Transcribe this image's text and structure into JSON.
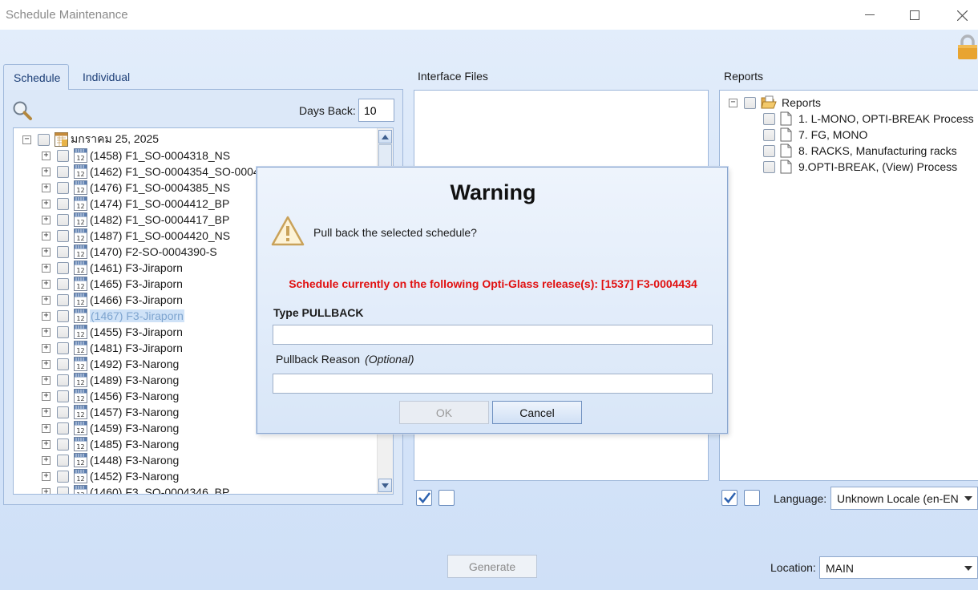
{
  "window": {
    "title": "Schedule Maintenance"
  },
  "tabs": [
    {
      "label": "Schedule",
      "active": true
    },
    {
      "label": "Individual",
      "active": false
    }
  ],
  "schedule": {
    "days_back_label": "Days Back:",
    "days_back_value": "10",
    "root_label": "มกราคม 25, 2025",
    "items": [
      {
        "label": "(1458) F1_SO-0004318_NS"
      },
      {
        "label": "(1462) F1_SO-0004354_SO-0004"
      },
      {
        "label": "(1476) F1_SO-0004385_NS"
      },
      {
        "label": "(1474) F1_SO-0004412_BP"
      },
      {
        "label": "(1482) F1_SO-0004417_BP"
      },
      {
        "label": "(1487) F1_SO-0004420_NS"
      },
      {
        "label": "(1470) F2-SO-0004390-S"
      },
      {
        "label": "(1461) F3-Jiraporn"
      },
      {
        "label": "(1465) F3-Jiraporn"
      },
      {
        "label": "(1466) F3-Jiraporn"
      },
      {
        "label": "(1467) F3-Jiraporn",
        "selected": true
      },
      {
        "label": "(1455) F3-Jiraporn"
      },
      {
        "label": "(1481) F3-Jiraporn"
      },
      {
        "label": "(1492) F3-Narong"
      },
      {
        "label": "(1489) F3-Narong"
      },
      {
        "label": "(1456) F3-Narong"
      },
      {
        "label": "(1457) F3-Narong"
      },
      {
        "label": "(1459) F3-Narong"
      },
      {
        "label": "(1485) F3-Narong"
      },
      {
        "label": "(1448) F3-Narong"
      },
      {
        "label": "(1452) F3-Narong"
      },
      {
        "label": "(1460) F3_SO-0004346_BP"
      }
    ]
  },
  "interface_files": {
    "label": "Interface Files"
  },
  "reports": {
    "label": "Reports",
    "root_label": "Reports",
    "items": [
      {
        "label": "1. L-MONO, OPTI-BREAK Process"
      },
      {
        "label": "7. FG, MONO"
      },
      {
        "label": "8. RACKS, Manufacturing racks"
      },
      {
        "label": "9.OPTI-BREAK, (View) Process"
      }
    ]
  },
  "language": {
    "label": "Language:",
    "value": "Unknown Locale (en-EN"
  },
  "location": {
    "label": "Location:",
    "value": "MAIN"
  },
  "generate_label": "Generate",
  "dialog": {
    "title": "Warning",
    "message": "Pull back the selected schedule?",
    "release_notice": "Schedule currently on the following Opti-Glass release(s): [1537] F3-0004434",
    "type_label": "Type PULLBACK",
    "reason_label": "Pullback Reason",
    "reason_optional": "(Optional)",
    "ok_label": "OK",
    "cancel_label": "Cancel"
  },
  "colors": {
    "accent": "#1d3f77",
    "warning_red": "#e11010",
    "lock_gold": "#e8a430"
  },
  "icons": [
    "search-icon",
    "lock-icon",
    "calendar-icon",
    "document-icon",
    "folder-open-icon",
    "warning-icon",
    "minimize-icon",
    "maximize-icon",
    "close-icon"
  ]
}
